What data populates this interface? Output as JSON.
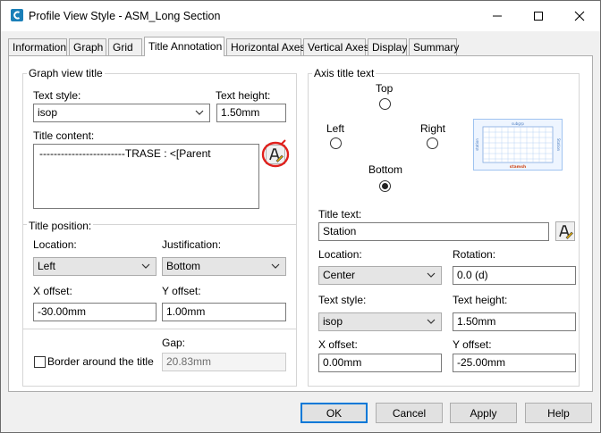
{
  "window": {
    "title": "Profile View Style - ASM_Long Section",
    "controls": {
      "minimize": "—",
      "maximize": "☐",
      "close": "✕"
    }
  },
  "tabs": [
    {
      "label": "Information"
    },
    {
      "label": "Graph"
    },
    {
      "label": "Grid"
    },
    {
      "label": "Title Annotation",
      "active": true
    },
    {
      "label": "Horizontal Axes"
    },
    {
      "label": "Vertical Axes"
    },
    {
      "label": "Display"
    },
    {
      "label": "Summary"
    }
  ],
  "graph_view_title": {
    "group_label": "Graph view title",
    "text_style_label": "Text style:",
    "text_style_value": "isop",
    "text_height_label": "Text height:",
    "text_height_value": "1.50mm",
    "title_content_label": "Title content:",
    "title_content_value": "------------------------TRASE               : <[Parent"
  },
  "title_position": {
    "group_label": "Title position:",
    "location_label": "Location:",
    "location_value": "Left",
    "justification_label": "Justification:",
    "justification_value": "Bottom",
    "x_offset_label": "X offset:",
    "x_offset_value": "-30.00mm",
    "y_offset_label": "Y offset:",
    "y_offset_value": "1.00mm"
  },
  "border": {
    "checkbox_label": "Border around the title",
    "checked": false,
    "gap_label": "Gap:",
    "gap_value": "20.83mm"
  },
  "axis_title_text": {
    "group_label": "Axis title text",
    "radio_top": "Top",
    "radio_left": "Left",
    "radio_right": "Right",
    "radio_bottom": "Bottom",
    "selected": "Bottom",
    "preview_top_label": "subgrp",
    "preview_left_label": "station",
    "preview_right_label": "Station",
    "preview_bottom_label": "stamsh",
    "title_text_label": "Title text:",
    "title_text_value": "Station",
    "location_label": "Location:",
    "location_value": "Center",
    "rotation_label": "Rotation:",
    "rotation_value": "0.0 (d)",
    "text_style_label": "Text style:",
    "text_style_value": "isop",
    "text_height_label": "Text height:",
    "text_height_value": "1.50mm",
    "x_offset_label": "X offset:",
    "x_offset_value": "0.00mm",
    "y_offset_label": "Y offset:",
    "y_offset_value": "-25.00mm"
  },
  "buttons": {
    "ok": "OK",
    "cancel": "Cancel",
    "apply": "Apply",
    "help": "Help"
  },
  "colors": {
    "accent": "#0078d7",
    "annotation": "#e0201c",
    "preview_grid": "#9fc3f0"
  }
}
